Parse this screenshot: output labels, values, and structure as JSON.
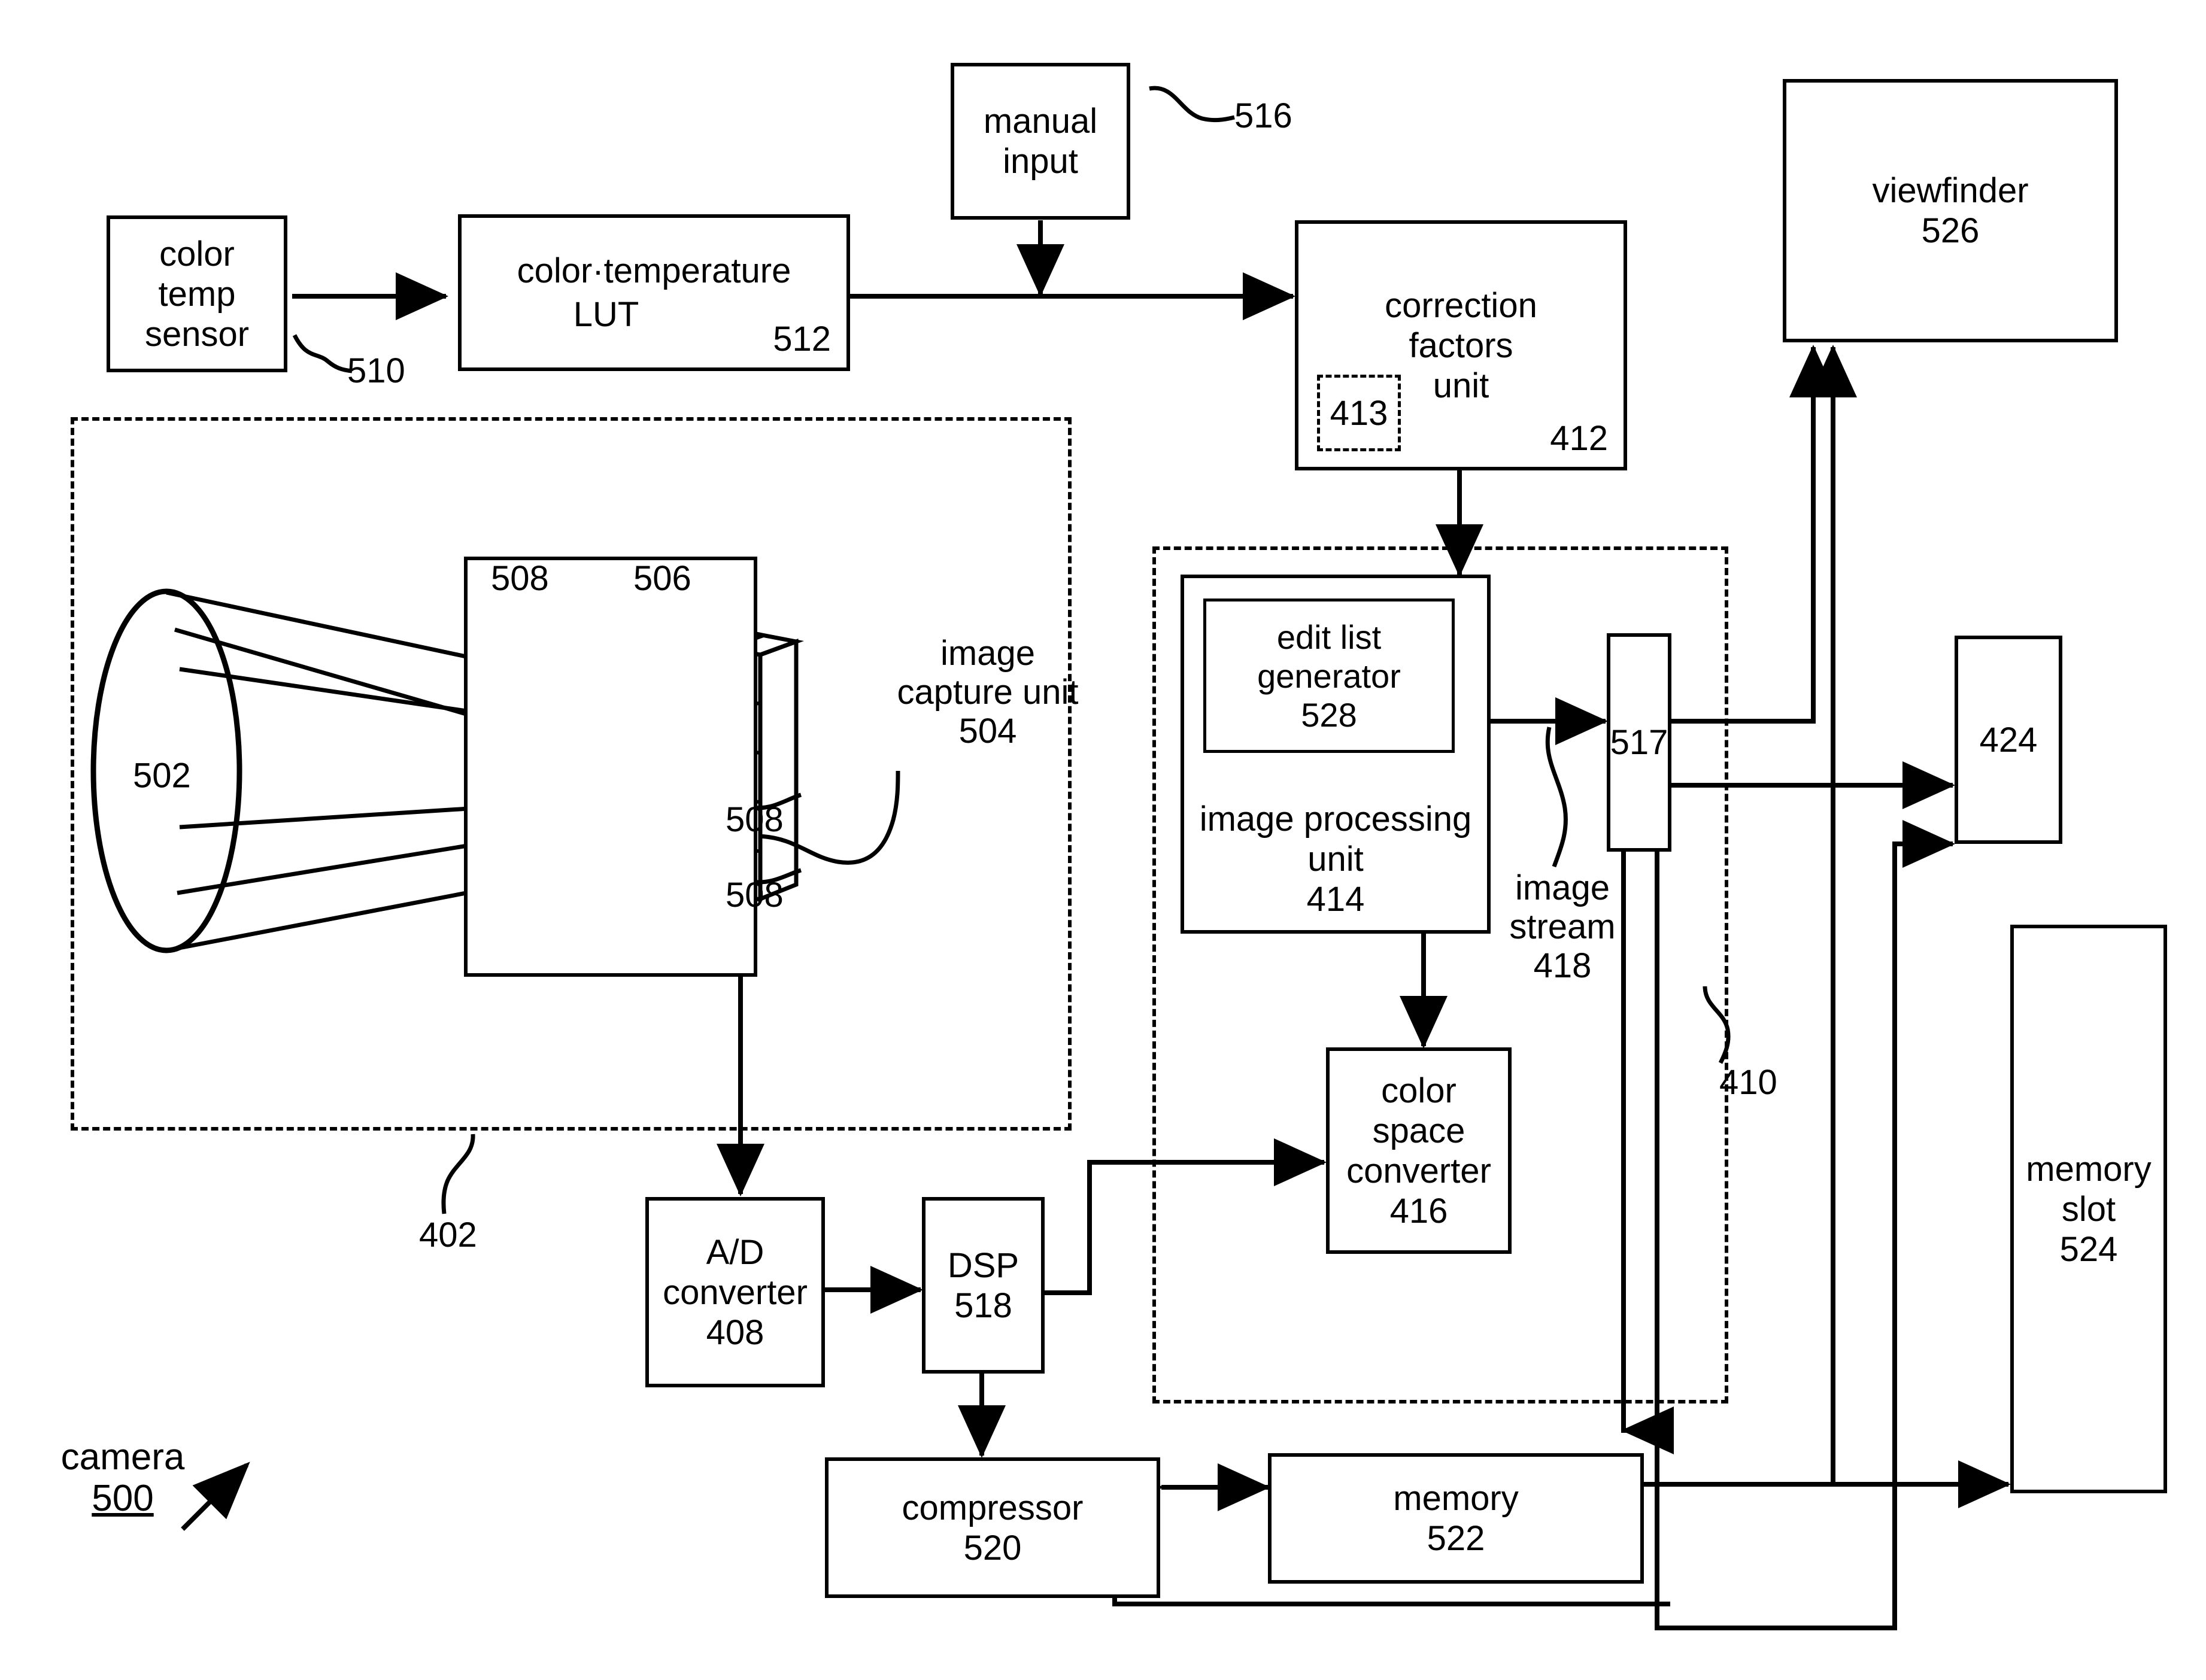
{
  "figure": {
    "title_label": "camera",
    "title_number": "500"
  },
  "blocks": {
    "color_temp_sensor": {
      "lines": [
        "color",
        "temp",
        "sensor"
      ],
      "ref": "510"
    },
    "color_temperature_lut": {
      "lines": [
        "color·temperature",
        "LUT"
      ],
      "ref": "512"
    },
    "manual_input": {
      "lines": [
        "manual",
        "input"
      ],
      "ref": "516"
    },
    "correction_factors_unit": {
      "lines": [
        "correction",
        "factors",
        "unit"
      ],
      "ref": "412",
      "inner_ref": "413"
    },
    "viewfinder": {
      "lines": [
        "viewfinder"
      ],
      "ref": "526"
    },
    "image_capture_unit": {
      "lines": [
        "image",
        "capture unit"
      ],
      "ref": "504"
    },
    "lens": {
      "ref": "502"
    },
    "sensor_array": {
      "ref": "506"
    },
    "sensor_elements": {
      "ref": "508",
      "ref2": "508",
      "ref3": "508"
    },
    "image_capture_group": {
      "ref": "402"
    },
    "ad_converter": {
      "lines": [
        "A/D",
        "converter"
      ],
      "ref": "408"
    },
    "dsp": {
      "lines": [
        "DSP"
      ],
      "ref": "518"
    },
    "edit_list_generator": {
      "lines": [
        "edit list",
        "generator"
      ],
      "ref": "528"
    },
    "image_processing_unit": {
      "lines": [
        "image processing",
        "unit"
      ],
      "ref": "414"
    },
    "color_space_converter": {
      "lines": [
        "color",
        "space",
        "converter"
      ],
      "ref": "416"
    },
    "image_stream": {
      "lines": [
        "image",
        "stream"
      ],
      "ref": "418"
    },
    "switch_517": {
      "ref": "517"
    },
    "output_424": {
      "ref": "424"
    },
    "memory_slot": {
      "lines": [
        "memory",
        "slot"
      ],
      "ref": "524"
    },
    "compressor": {
      "lines": [
        "compressor"
      ],
      "ref": "520"
    },
    "memory": {
      "lines": [
        "memory"
      ],
      "ref": "522"
    },
    "processing_group": {
      "ref": "410"
    }
  },
  "colors": {
    "ink": "#000000",
    "paper": "#ffffff"
  }
}
